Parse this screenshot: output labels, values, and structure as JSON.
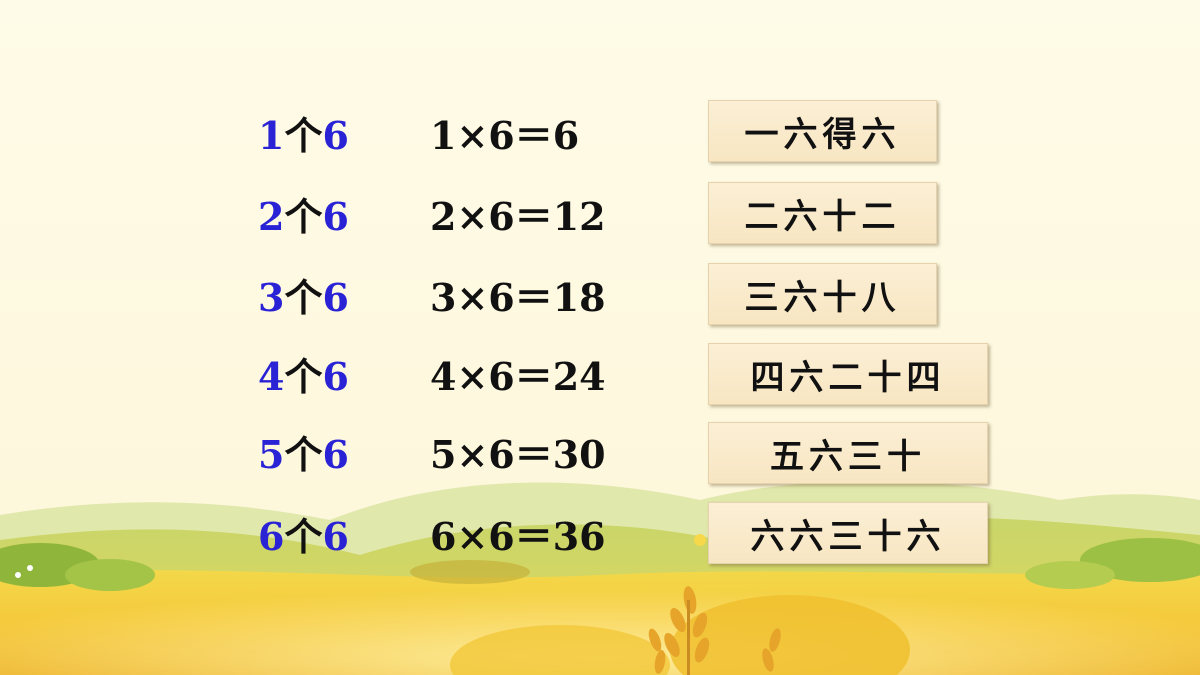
{
  "rows": [
    {
      "n": "1",
      "unit": "个",
      "six": "6",
      "equation": "1×6＝6",
      "rhyme": "一六得六"
    },
    {
      "n": "2",
      "unit": "个",
      "six": "6",
      "equation": "2×6＝12",
      "rhyme": "二六十二"
    },
    {
      "n": "3",
      "unit": "个",
      "six": "6",
      "equation": "3×6＝18",
      "rhyme": "三六十八"
    },
    {
      "n": "4",
      "unit": "个",
      "six": "6",
      "equation": "4×6＝24",
      "rhyme": "四六二十四"
    },
    {
      "n": "5",
      "unit": "个",
      "six": "6",
      "equation": "5×6＝30",
      "rhyme": "五六三十"
    },
    {
      "n": "6",
      "unit": "个",
      "six": "6",
      "equation": "6×6＝36",
      "rhyme": "六六三十六"
    }
  ],
  "colors": {
    "background": "#fefbe6",
    "accent_number": "#2a23d6",
    "text": "#111111",
    "card": "#f8e6c2"
  }
}
